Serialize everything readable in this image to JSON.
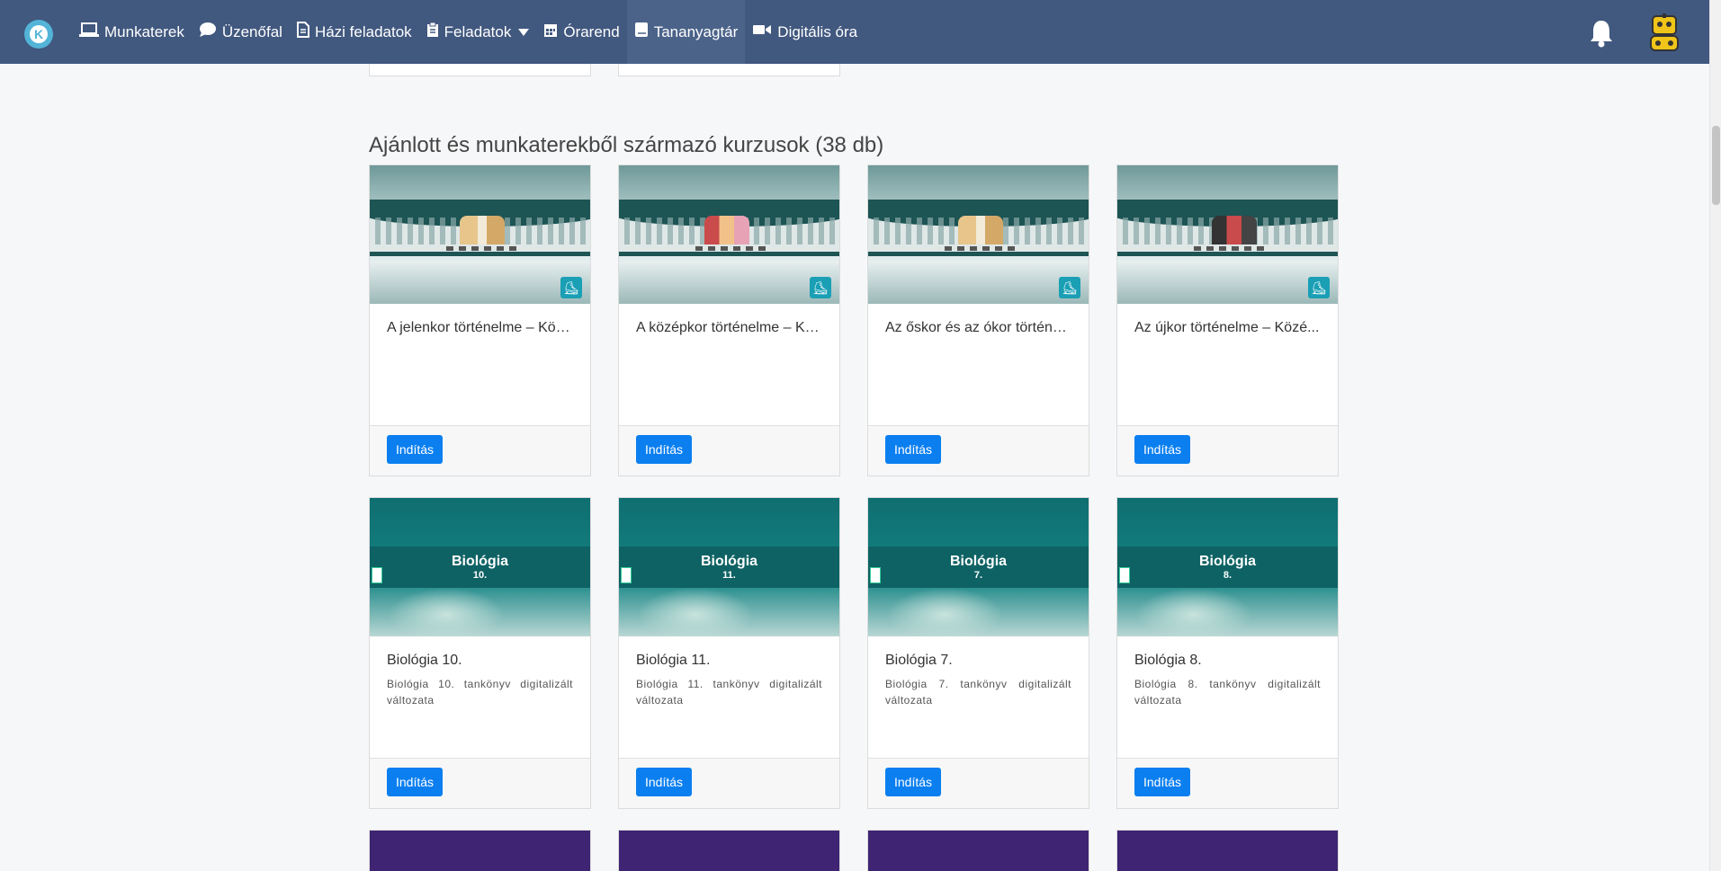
{
  "nav": {
    "logo": "K",
    "items": [
      {
        "label": "Munkaterek",
        "icon": "laptop-icon"
      },
      {
        "label": "Üzenőfal",
        "icon": "chat-icon"
      },
      {
        "label": "Házi feladatok",
        "icon": "document-icon"
      },
      {
        "label": "Feladatok",
        "icon": "clipboard-icon"
      },
      {
        "label": "Órarend",
        "icon": "calendar-icon"
      },
      {
        "label": "Tananyagtár",
        "icon": "book-icon"
      },
      {
        "label": "Digitális óra",
        "icon": "video-icon"
      }
    ]
  },
  "section": {
    "title": "Ajánlott és munkaterekből származó kurzusok (38 db)"
  },
  "cards": [
    {
      "title": "A jelenkor történelme – Köz...",
      "desc": "",
      "button": "Indítás"
    },
    {
      "title": "A középkor történelme – Kö...",
      "desc": "",
      "button": "Indítás"
    },
    {
      "title": "Az őskor és az ókor történel...",
      "desc": "",
      "button": "Indítás"
    },
    {
      "title": "Az újkor történelme – Közé...",
      "desc": "",
      "button": "Indítás"
    },
    {
      "title": "Biológia 10.",
      "desc": "Biológia 10. tankönyv digitalizált változata",
      "button": "Indítás",
      "banner_title": "Biológia",
      "banner_num": "10."
    },
    {
      "title": "Biológia 11.",
      "desc": "Biológia 11. tankönyv digitalizált változata",
      "button": "Indítás",
      "banner_title": "Biológia",
      "banner_num": "11."
    },
    {
      "title": "Biológia 7.",
      "desc": "Biológia 7. tankönyv digitalizált változata",
      "button": "Indítás",
      "banner_title": "Biológia",
      "banner_num": "7."
    },
    {
      "title": "Biológia 8.",
      "desc": "Biológia 8. tankönyv digitalizált változata",
      "button": "Indítás",
      "banner_title": "Biológia",
      "banner_num": "8."
    }
  ],
  "colors": {
    "navbar": "#41587f",
    "button": "#0b7ff0",
    "biology": "#137c7d",
    "purple": "#3f2473"
  }
}
